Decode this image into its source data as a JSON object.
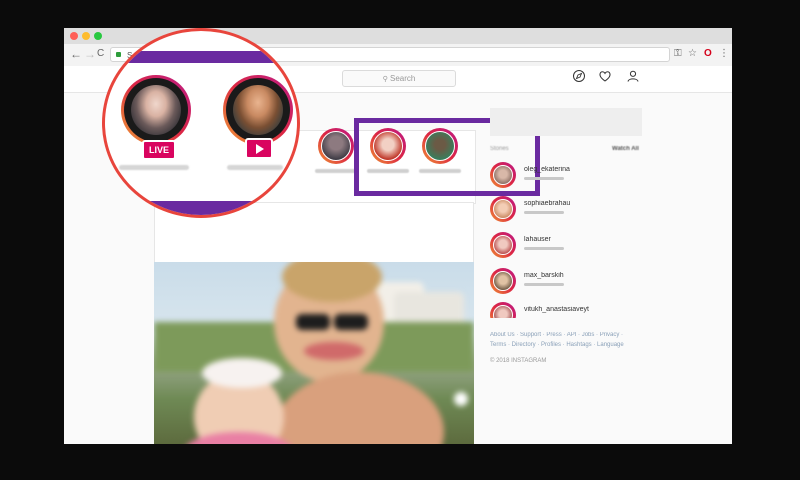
{
  "browser": {
    "url_text": "Se",
    "icons": {
      "back": "back-arrow-icon",
      "forward": "forward-arrow-icon",
      "reload": "reload-icon",
      "key": "key-icon",
      "bookmark": "star-icon",
      "extension": "opera-icon",
      "menu": "kebab-menu-icon"
    },
    "glyphs": {
      "back": "←",
      "forward": "→",
      "reload": "C",
      "key": "⚿",
      "star": "☆",
      "opera": "O",
      "menu": "⋮"
    }
  },
  "header": {
    "search_placeholder": "Search",
    "search_glyph": "⚲",
    "icons": [
      "compass-icon",
      "heart-icon",
      "profile-icon"
    ]
  },
  "zoom_callout": {
    "live_label": "LIVE",
    "border_color": "#e8453c",
    "highlight_color": "#6a2aa0"
  },
  "stories_strip": {
    "highlight_color": "#6a2aa0"
  },
  "sidebar": {
    "heading": "Stories",
    "watch_all": "Watch All",
    "stories": [
      {
        "username": "oleg_ekaterina"
      },
      {
        "username": "sophiaebrahau"
      },
      {
        "username": "lahauser"
      },
      {
        "username": "max_barskih"
      },
      {
        "username": "vitukh_anastasiaveyt"
      }
    ],
    "footer_links": "About Us · Support · Press · API · Jobs · Privacy · Terms · Directory · Profiles · Hashtags · Language",
    "copyright": "© 2018 INSTAGRAM"
  },
  "colors": {
    "story_ring": "#dc2743",
    "live_badge": "#d9045f"
  }
}
